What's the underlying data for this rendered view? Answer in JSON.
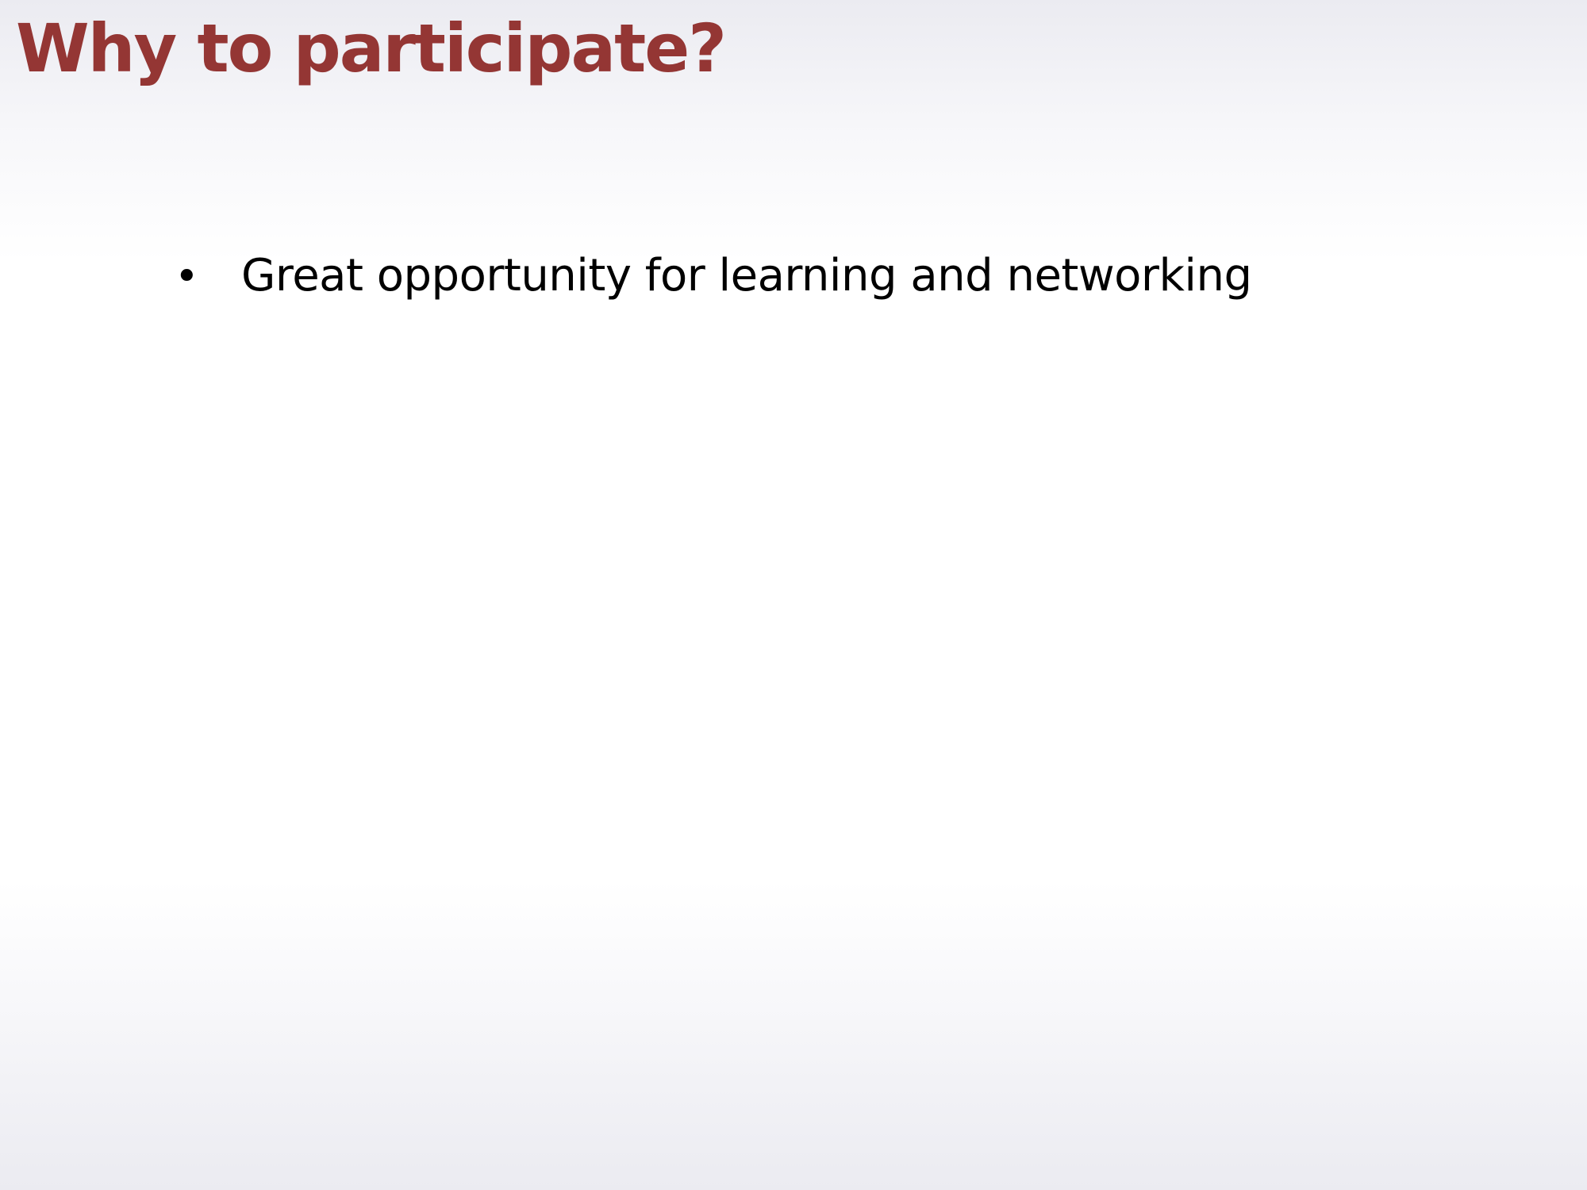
{
  "slide": {
    "title": "Why to participate?",
    "bullets": [
      {
        "marker": "•",
        "text": "Great opportunity for learning and networking"
      }
    ]
  },
  "colors": {
    "title": "#943634",
    "body_text": "#000000",
    "background_center": "#ffffff",
    "background_edge": "#ebebf1"
  }
}
